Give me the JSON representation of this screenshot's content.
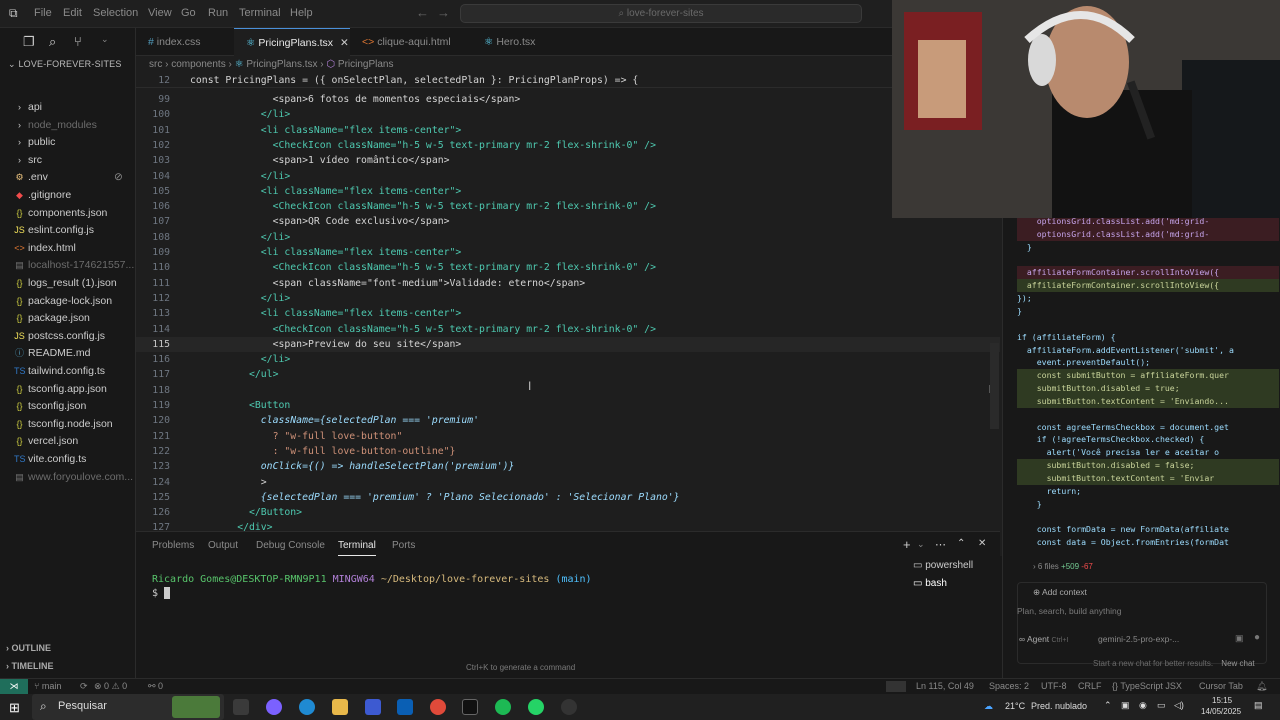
{
  "menu": [
    "File",
    "Edit",
    "Selection",
    "View",
    "Go",
    "Run",
    "Terminal",
    "Help"
  ],
  "command_center": "love-forever-sites",
  "sidebar": {
    "title": "LOVE-FOREVER-SITES",
    "items": [
      {
        "label": "api",
        "type": "folder",
        "dim": false
      },
      {
        "label": "node_modules",
        "type": "folder",
        "dim": true
      },
      {
        "label": "public",
        "type": "folder",
        "dim": false
      },
      {
        "label": "src",
        "type": "folder",
        "dim": false
      },
      {
        "label": ".env",
        "type": "env",
        "dim": false
      },
      {
        "label": ".gitignore",
        "type": "git",
        "dim": false
      },
      {
        "label": "components.json",
        "type": "json",
        "dim": false
      },
      {
        "label": "eslint.config.js",
        "type": "js",
        "dim": false
      },
      {
        "label": "index.html",
        "type": "html",
        "dim": false
      },
      {
        "label": "localhost-174621557...",
        "type": "file",
        "dim": true
      },
      {
        "label": "logs_result (1).json",
        "type": "json",
        "dim": false
      },
      {
        "label": "package-lock.json",
        "type": "json",
        "dim": false
      },
      {
        "label": "package.json",
        "type": "json",
        "dim": false
      },
      {
        "label": "postcss.config.js",
        "type": "js",
        "dim": false
      },
      {
        "label": "README.md",
        "type": "md",
        "dim": false
      },
      {
        "label": "tailwind.config.ts",
        "type": "ts",
        "dim": false
      },
      {
        "label": "tsconfig.app.json",
        "type": "json",
        "dim": false
      },
      {
        "label": "tsconfig.json",
        "type": "json",
        "dim": false
      },
      {
        "label": "tsconfig.node.json",
        "type": "json",
        "dim": false
      },
      {
        "label": "vercel.json",
        "type": "json",
        "dim": false
      },
      {
        "label": "vite.config.ts",
        "type": "ts",
        "dim": false
      },
      {
        "label": "www.foryoulove.com...",
        "type": "file",
        "dim": true
      }
    ],
    "outline": "OUTLINE",
    "timeline": "TIMELINE"
  },
  "tabs": [
    {
      "label": "index.css",
      "icon": "#"
    },
    {
      "label": "PricingPlans.tsx",
      "icon": "⚛",
      "active": true
    },
    {
      "label": "clique-aqui.html",
      "icon": "<>"
    },
    {
      "label": "Hero.tsx",
      "icon": "⚛"
    }
  ],
  "breadcrumb": {
    "src": "src",
    "components": "components",
    "file": "PricingPlans.tsx",
    "symbol": "PricingPlans"
  },
  "sticky_line": {
    "num": "12",
    "code": "const PricingPlans = ({ onSelectPlan, selectedPlan }: PricingPlanProps) => {"
  },
  "code_lines": [
    {
      "num": "99",
      "text": "<span>6 fotos de momentos especiais</span>"
    },
    {
      "num": "100",
      "text": "</li>"
    },
    {
      "num": "101",
      "text": "<li className=\"flex items-center\">"
    },
    {
      "num": "102",
      "text": "<CheckIcon className=\"h-5 w-5 text-primary mr-2 flex-shrink-0\" />"
    },
    {
      "num": "103",
      "text": "<span>1 vídeo romântico</span>"
    },
    {
      "num": "104",
      "text": "</li>"
    },
    {
      "num": "105",
      "text": "<li className=\"flex items-center\">"
    },
    {
      "num": "106",
      "text": "<CheckIcon className=\"h-5 w-5 text-primary mr-2 flex-shrink-0\" />"
    },
    {
      "num": "107",
      "text": "<span>QR Code exclusivo</span>"
    },
    {
      "num": "108",
      "text": "</li>"
    },
    {
      "num": "109",
      "text": "<li className=\"flex items-center\">"
    },
    {
      "num": "110",
      "text": "<CheckIcon className=\"h-5 w-5 text-primary mr-2 flex-shrink-0\" />"
    },
    {
      "num": "111",
      "text": "<span className=\"font-medium\">Validade: eterno</span>"
    },
    {
      "num": "112",
      "text": "</li>"
    },
    {
      "num": "113",
      "text": "<li className=\"flex items-center\">"
    },
    {
      "num": "114",
      "text": "<CheckIcon className=\"h-5 w-5 text-primary mr-2 flex-shrink-0\" />"
    },
    {
      "num": "115",
      "text": "<span>Preview do seu site</span>",
      "current": true
    },
    {
      "num": "116",
      "text": "</li>"
    },
    {
      "num": "117",
      "text": "</ul>"
    },
    {
      "num": "118",
      "text": ""
    },
    {
      "num": "119",
      "text": "<Button"
    },
    {
      "num": "120",
      "text": "className={selectedPlan === 'premium'"
    },
    {
      "num": "121",
      "text": "? \"w-full love-button\""
    },
    {
      "num": "122",
      "text": ": \"w-full love-button-outline\"}"
    },
    {
      "num": "123",
      "text": "onClick={() => handleSelectPlan('premium')}"
    },
    {
      "num": "124",
      "text": ">"
    },
    {
      "num": "125",
      "text": "{selectedPlan === 'premium' ? 'Plano Selecionado' : 'Selecionar Plano'}"
    },
    {
      "num": "126",
      "text": "</Button>"
    },
    {
      "num": "127",
      "text": "</div>"
    }
  ],
  "panel": {
    "tabs": [
      "Problems",
      "Output",
      "Debug Console",
      "Terminal",
      "Ports"
    ],
    "active_tab": "Terminal",
    "prompt_user": "Ricardo Gomes@DESKTOP-RMN9P11",
    "prompt_env": "MINGW64",
    "prompt_path": "~/Desktop/love-forever-sites",
    "prompt_branch": "(main)",
    "prompt_symbol": "$",
    "hint": "Ctrl+K to generate a command",
    "terminals": [
      "powershell",
      "bash"
    ]
  },
  "chat": {
    "diff_lines": [
      {
        "text": "    optionsGrid.classList.add('md:grid-",
        "kind": "del"
      },
      {
        "text": "    optionsGrid.classList.add('md:grid-",
        "kind": "del"
      },
      {
        "text": "  }",
        "kind": "ctx"
      },
      {
        "text": "",
        "kind": "ctx"
      },
      {
        "text": "  affiliateFormContainer.scrollIntoView({",
        "kind": "del"
      },
      {
        "text": "  affiliateFormContainer.scrollIntoView({",
        "kind": "add"
      },
      {
        "text": "});",
        "kind": "ctx"
      },
      {
        "text": "}",
        "kind": "ctx"
      },
      {
        "text": "",
        "kind": "ctx"
      },
      {
        "text": "if (affiliateForm) {",
        "kind": "ctx"
      },
      {
        "text": "  affiliateForm.addEventListener('submit', a",
        "kind": "ctx"
      },
      {
        "text": "    event.preventDefault();",
        "kind": "ctx"
      },
      {
        "text": "    const submitButton = affiliateForm.quer",
        "kind": "add"
      },
      {
        "text": "    submitButton.disabled = true;",
        "kind": "add"
      },
      {
        "text": "    submitButton.textContent = 'Enviando...",
        "kind": "add"
      },
      {
        "text": "",
        "kind": "ctx"
      },
      {
        "text": "    const agreeTermsCheckbox = document.get",
        "kind": "ctx"
      },
      {
        "text": "    if (!agreeTermsCheckbox.checked) {",
        "kind": "ctx"
      },
      {
        "text": "      alert('Você precisa ler e aceitar o",
        "kind": "ctx"
      },
      {
        "text": "      submitButton.disabled = false;",
        "kind": "add"
      },
      {
        "text": "      submitButton.textContent = 'Enviar",
        "kind": "add"
      },
      {
        "text": "      return;",
        "kind": "ctx"
      },
      {
        "text": "    }",
        "kind": "ctx"
      },
      {
        "text": "",
        "kind": "ctx"
      },
      {
        "text": "    const formData = new FormData(affiliate",
        "kind": "ctx"
      },
      {
        "text": "    const data = Object.fromEntries(formDat",
        "kind": "ctx"
      }
    ],
    "files_changed": "6 files",
    "additions": "+509",
    "deletions": "-67",
    "add_context": "Add context",
    "input_placeholder": "Plan, search, build anything",
    "agent": "Agent",
    "agent_shortcut": "Ctrl+I",
    "model": "gemini-2.5-pro-exp-...",
    "footer": "Start a new chat for better results.",
    "new_chat": "New chat"
  },
  "statusbar": {
    "branch": "main",
    "errors": "0",
    "warnings": "0",
    "ports": "0",
    "position": "Ln 115, Col 49",
    "spaces": "Spaces: 2",
    "encoding": "UTF-8",
    "eol": "CRLF",
    "language": "TypeScript JSX",
    "cursor_tab": "Cursor Tab"
  },
  "taskbar": {
    "search": "Pesquisar",
    "weather": "21°C",
    "weather_desc": "Pred. nublado",
    "time": "15:15",
    "date": "14/05/2025"
  },
  "colors": {
    "accent": "#0078d4",
    "terminal_bg": "#181818",
    "del_bg": "#3b1d22",
    "add_bg": "#2f3a22"
  }
}
